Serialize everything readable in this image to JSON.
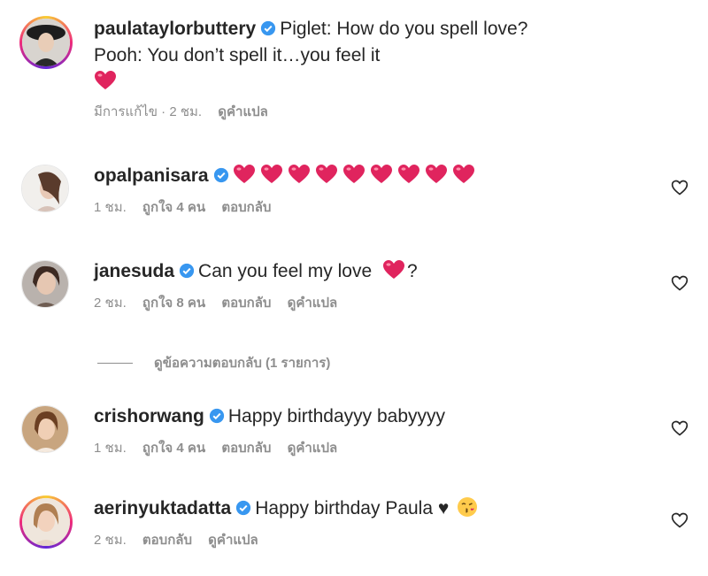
{
  "comments": [
    {
      "username": "paulataylorbuttery",
      "text_line1": "Piglet: How do you spell love?",
      "text_line2": "Pooh: You don’t spell it…you feel it",
      "edited": "มีการแก้ไข · 2 ชม.",
      "translate": "ดูคำแปล"
    },
    {
      "username": "opalpanisara",
      "heart_count": 9,
      "time": "1 ชม.",
      "likes": "ถูกใจ 4 คน",
      "reply": "ตอบกลับ"
    },
    {
      "username": "janesuda",
      "text": "Can you feel my love",
      "text_suffix": "?",
      "time": "2 ชม.",
      "likes": "ถูกใจ 8 คน",
      "reply": "ตอบกลับ",
      "translate": "ดูคำแปล"
    },
    {
      "username": "crishorwang",
      "text": "Happy birthdayyy babyyyy",
      "time": "1 ชม.",
      "likes": "ถูกใจ 4 คน",
      "reply": "ตอบกลับ",
      "translate": "ดูคำแปล"
    },
    {
      "username": "aerinyuktadatta",
      "text": "Happy birthday Paula ♥",
      "time": "2 ชม.",
      "reply": "ตอบกลับ",
      "translate": "ดูคำแปล"
    }
  ],
  "view_replies": "ดูข้อความตอบกลับ (1 รายการ)",
  "colors": {
    "verified": "#3897f0",
    "heart": "#e0245e",
    "muted": "#8e8e8e"
  },
  "icons": [
    "verified-badge-icon",
    "heart-emoji-icon",
    "like-heart-icon",
    "kiss-face-emoji-icon"
  ]
}
